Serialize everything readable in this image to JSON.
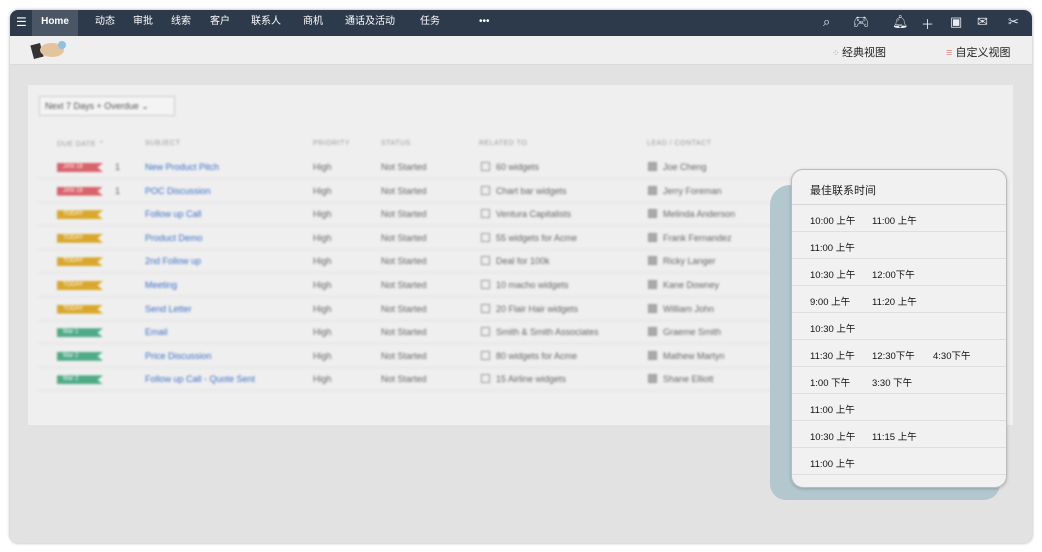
{
  "nav": {
    "menu_icon": "hamburger-icon",
    "home": "Home",
    "items": [
      "动态",
      "审批",
      "线索",
      "客户",
      "联系人",
      "商机",
      "通话及活动",
      "任务"
    ],
    "more": "•••",
    "icons": [
      "search-icon",
      "gamepad-icon",
      "bell-icon",
      "plus-icon",
      "calendar-icon",
      "mail-icon",
      "tools-icon"
    ]
  },
  "subbar": {
    "classic_view": "经典视图",
    "custom_view": "自定义视图"
  },
  "filter": {
    "value": "Next 7 Days + Overdue"
  },
  "columns": [
    "DUE DATE",
    "SUBJECT",
    "PRIORITY",
    "STATUS",
    "RELATED TO",
    "LEAD / CONTACT"
  ],
  "rows": [
    {
      "due": "JAN 18",
      "count": "1",
      "subject": "New Product Pitch",
      "priority": "High",
      "status": "Not Started",
      "related": "60 widgets",
      "contact": "Joe Cheng",
      "color": "#d9636b"
    },
    {
      "due": "JAN 18",
      "count": "1",
      "subject": "POC Discussion",
      "priority": "High",
      "status": "Not Started",
      "related": "Chart bar widgets",
      "contact": "Jerry Foreman",
      "color": "#d9636b"
    },
    {
      "due": "TODAY",
      "count": "",
      "subject": "Follow up Call",
      "priority": "High",
      "status": "Not Started",
      "related": "Ventura Capitalists",
      "contact": "Melinda Anderson",
      "color": "#d9a72b"
    },
    {
      "due": "TODAY",
      "count": "",
      "subject": "Product Demo",
      "priority": "High",
      "status": "Not Started",
      "related": "55 widgets for Acme",
      "contact": "Frank Fernandez",
      "color": "#d9a72b"
    },
    {
      "due": "TODAY",
      "count": "",
      "subject": "2nd Follow up",
      "priority": "High",
      "status": "Not Started",
      "related": "Deal for 100k",
      "contact": "Ricky Langer",
      "color": "#d9a72b"
    },
    {
      "due": "TODAY",
      "count": "",
      "subject": "Meeting",
      "priority": "High",
      "status": "Not Started",
      "related": "10 macho widgets",
      "contact": "Kane Downey",
      "color": "#d9a72b"
    },
    {
      "due": "TODAY",
      "count": "",
      "subject": "Send Letter",
      "priority": "High",
      "status": "Not Started",
      "related": "20 Flair Hair widgets",
      "contact": "William John",
      "color": "#d9a72b"
    },
    {
      "due": "Mar 1",
      "count": "",
      "subject": "Email",
      "priority": "High",
      "status": "Not Started",
      "related": "Smith & Smith Associates",
      "contact": "Graeme Smith",
      "color": "#4fab86"
    },
    {
      "due": "Mar 2",
      "count": "",
      "subject": "Price Discussion",
      "priority": "High",
      "status": "Not Started",
      "related": "80 widgets for Acme",
      "contact": "Mathew Martyn",
      "color": "#4fab86"
    },
    {
      "due": "Mar 2",
      "count": "",
      "subject": "Follow up Call - Quote Sent",
      "priority": "High",
      "status": "Not Started",
      "related": "15 Airline widgets",
      "contact": "Shane Elliott",
      "color": "#4fab86"
    }
  ],
  "popup": {
    "title": "最佳联系时间",
    "rows": [
      [
        "10:00 上午",
        "11:00 上午"
      ],
      [
        "11:00  上午"
      ],
      [
        "10:30 上午",
        "12:00下午"
      ],
      [
        "9:00  上午",
        "11:20 上午"
      ],
      [
        "10:30 上午"
      ],
      [
        "11:30  上午",
        "12:30下午",
        "4:30下午"
      ],
      [
        "1:00   下午",
        "3:30  下午"
      ],
      [
        "11:00  上午"
      ],
      [
        "10:30 上午",
        "11:15  上午"
      ],
      [
        "11:00  上午"
      ]
    ]
  }
}
